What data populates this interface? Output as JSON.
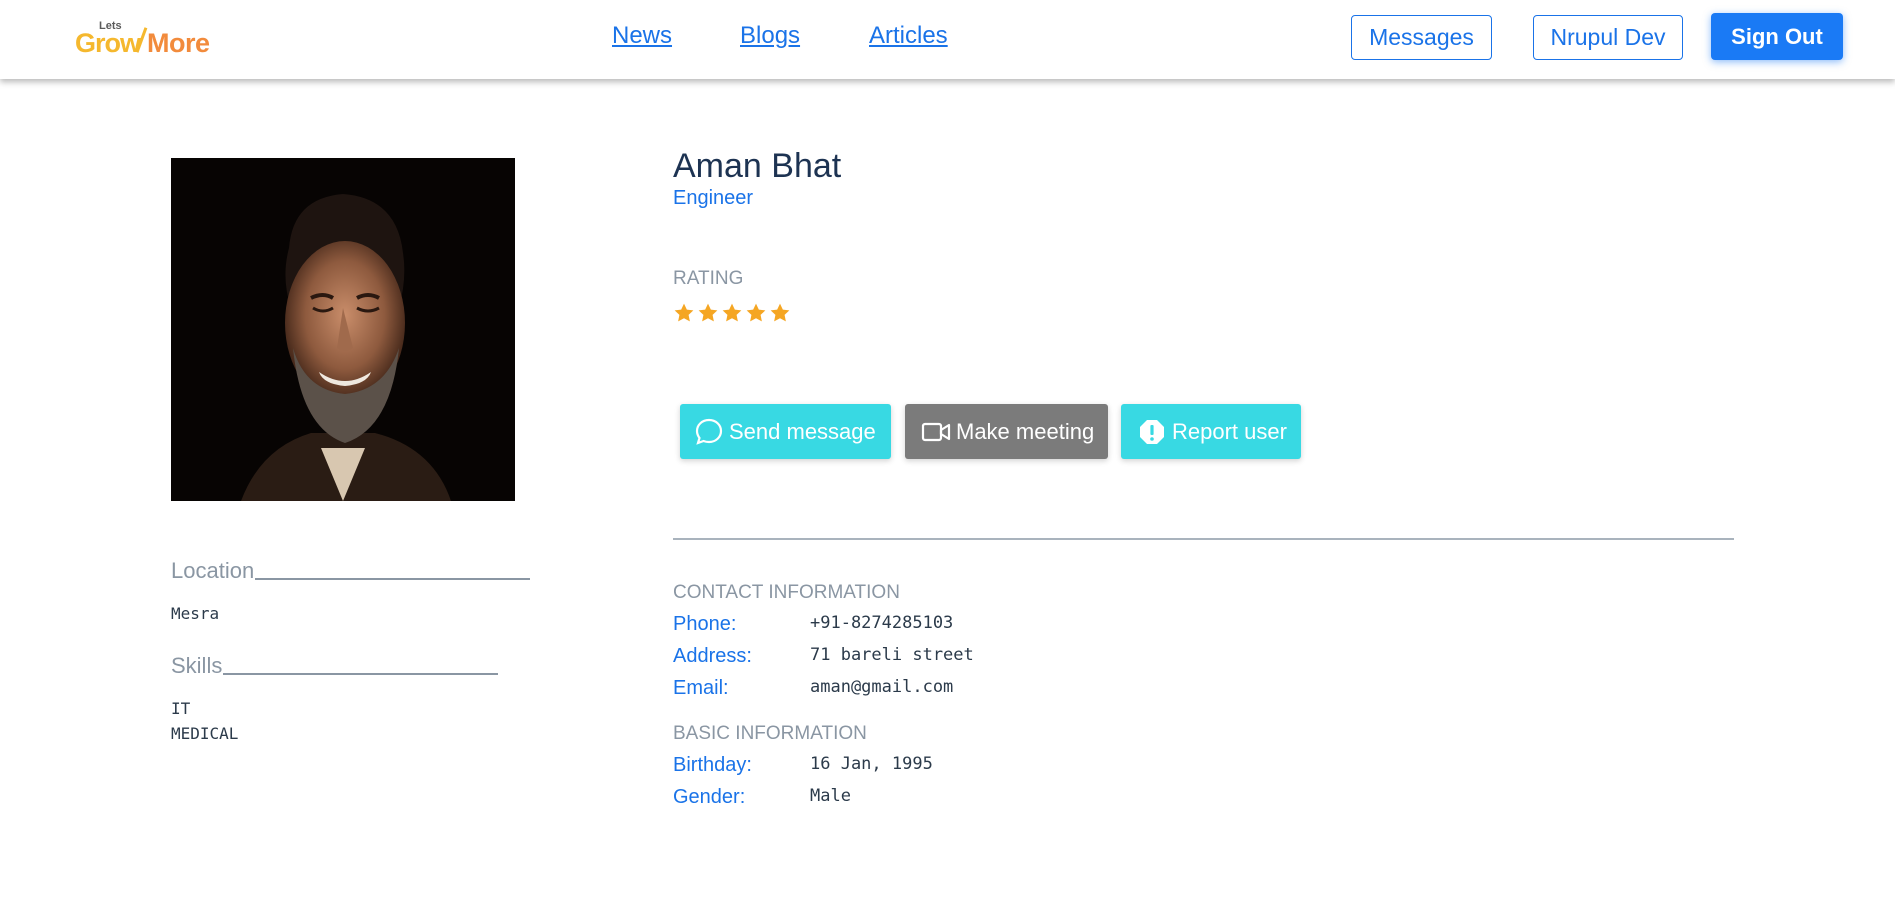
{
  "logo": {
    "top": "Lets",
    "part1": "Grow",
    "part2": "More"
  },
  "nav": {
    "news": "News",
    "blogs": "Blogs",
    "articles": "Articles"
  },
  "header_actions": {
    "messages": "Messages",
    "user": "Nrupul Dev",
    "signout": "Sign Out"
  },
  "profile": {
    "name": "Aman Bhat",
    "role": "Engineer",
    "rating_label": "RATING",
    "rating_value": 5,
    "rating_max": 5,
    "star_color": "#f5a623"
  },
  "sidebar": {
    "location_label": "Location",
    "location_value": "Mesra",
    "skills_label": "Skills",
    "skills": [
      "IT",
      "MEDICAL"
    ]
  },
  "actions": {
    "send": "Send message",
    "meeting": "Make meeting",
    "report": "Report user"
  },
  "contact": {
    "heading": "CONTACT INFORMATION",
    "phone_label": "Phone:",
    "phone": "+91-8274285103",
    "address_label": "Address:",
    "address": "71 bareli street",
    "email_label": "Email:",
    "email": "aman@gmail.com"
  },
  "basic": {
    "heading": "BASIC INFORMATION",
    "birthday_label": "Birthday:",
    "birthday": "16 Jan, 1995",
    "gender_label": "Gender:",
    "gender": "Male"
  },
  "colors": {
    "primary": "#1a73e8",
    "cyan": "#38d9e3",
    "gray": "#7b7b7b"
  }
}
